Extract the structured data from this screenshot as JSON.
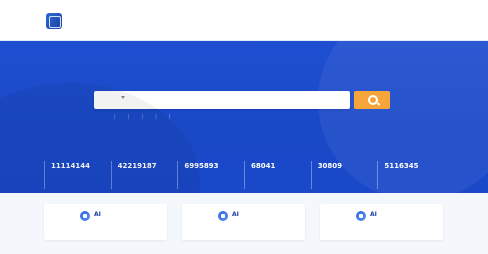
{
  "top_strip": {
    "text": ""
  },
  "header": {
    "logo_caption": "",
    "title": "",
    "subtitle": ""
  },
  "search": {
    "scope": "",
    "placeholder": "",
    "advanced_label": "",
    "quick_links": [
      "",
      "",
      "",
      "",
      "",
      ""
    ]
  },
  "stats": [
    {
      "value": "11114144",
      "unit": "",
      "label": ""
    },
    {
      "value": "42219187",
      "unit": "",
      "label": ""
    },
    {
      "value": "6995893",
      "unit": "",
      "label": ""
    },
    {
      "value": "68041",
      "unit": "",
      "label": ""
    },
    {
      "value": "30809",
      "unit": "",
      "label": ""
    },
    {
      "value": "5116345",
      "unit": "",
      "label": ""
    }
  ],
  "cards": [
    {
      "title": "AI",
      "desc": ""
    },
    {
      "title": "AI",
      "desc": ""
    },
    {
      "title": "AI",
      "desc": ""
    }
  ],
  "colors": {
    "brand": "#1b3f9e",
    "hero": "#1f4fd1",
    "accent_button": "#f6a53a"
  },
  "icons": {
    "logo": "library-logo-icon",
    "search": "search-icon",
    "cards": [
      "ai-chat-icon",
      "ai-read-icon",
      "ai-write-icon"
    ]
  }
}
